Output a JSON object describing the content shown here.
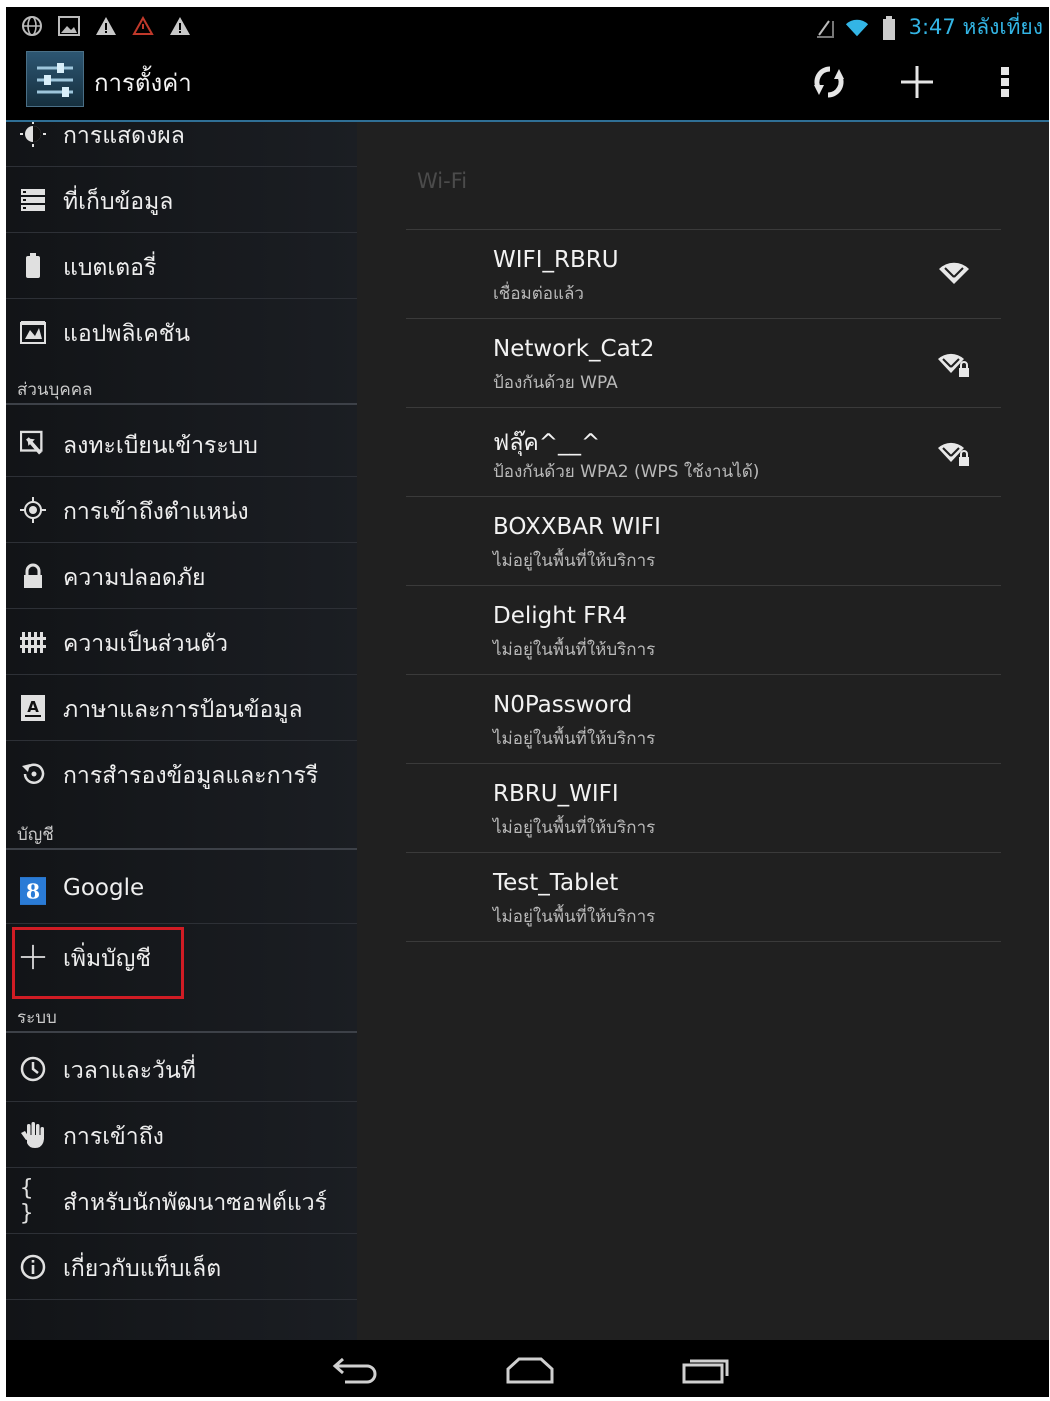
{
  "status_bar": {
    "time": "3:47 หลังเที่ยง",
    "left_icons": [
      "globe-icon",
      "image-icon",
      "warning-icon",
      "warning-outline-icon",
      "warning-icon"
    ],
    "right_icons": [
      "no-signal-icon",
      "wifi-icon",
      "battery-icon"
    ]
  },
  "action_bar": {
    "title": "การตั้งค่า",
    "actions": [
      "sync-icon",
      "add-icon",
      "overflow-menu-icon"
    ]
  },
  "sidebar": {
    "items": [
      {
        "label": "การแสดงผล",
        "icon": "brightness-icon"
      },
      {
        "label": "ที่เก็บข้อมูล",
        "icon": "storage-icon"
      },
      {
        "label": "แบตเตอรี่",
        "icon": "battery-icon"
      },
      {
        "label": "แอปพลิเคชัน",
        "icon": "apps-icon"
      },
      {
        "header": "ส่วนบุคคล"
      },
      {
        "label": "ลงทะเบียนเข้าระบบ",
        "icon": "signin-icon"
      },
      {
        "label": "การเข้าถึงตำแหน่ง",
        "icon": "location-icon"
      },
      {
        "label": "ความปลอดภัย",
        "icon": "lock-icon"
      },
      {
        "label": "ความเป็นส่วนตัว",
        "icon": "privacy-icon"
      },
      {
        "label": "ภาษาและการป้อนข้อมูล",
        "icon": "language-icon"
      },
      {
        "label": "การสำรองข้อมูลและการรี",
        "icon": "backup-icon"
      },
      {
        "header": "บัญชี"
      },
      {
        "label": "Google",
        "icon": "google-icon"
      },
      {
        "label": "เพิ่มบัญชี",
        "icon": "add-account-icon"
      },
      {
        "header": "ระบบ"
      },
      {
        "label": "เวลาและวันที่",
        "icon": "clock-icon"
      },
      {
        "label": "การเข้าถึง",
        "icon": "hand-icon"
      },
      {
        "label": "สำหรับนักพัฒนาซอฟต์แวร์",
        "icon": "braces-icon"
      },
      {
        "label": "เกี่ยวกับแท็บเล็ต",
        "icon": "info-icon"
      }
    ]
  },
  "wifi": {
    "header": "Wi-Fi",
    "networks": [
      {
        "ssid": "WIFI_RBRU",
        "status": "เชื่อมต่อแล้ว",
        "signal_icon": "wifi-signal-icon"
      },
      {
        "ssid": "Network_Cat2",
        "status": "ป้องกันด้วย WPA",
        "signal_icon": "wifi-locked-icon"
      },
      {
        "ssid": "ฟลุ๊ค^__^",
        "status": "ป้องกันด้วย WPA2 (WPS ใช้งานได้)",
        "signal_icon": "wifi-locked-icon"
      },
      {
        "ssid": "BOXXBAR WIFI",
        "status": "ไม่อยู่ในพื้นที่ให้บริการ"
      },
      {
        "ssid": "Delight FR4",
        "status": "ไม่อยู่ในพื้นที่ให้บริการ"
      },
      {
        "ssid": "N0Password",
        "status": "ไม่อยู่ในพื้นที่ให้บริการ"
      },
      {
        "ssid": "RBRU_WIFI",
        "status": "ไม่อยู่ในพื้นที่ให้บริการ"
      },
      {
        "ssid": "Test_Tablet",
        "status": "ไม่อยู่ในพื้นที่ให้บริการ"
      }
    ]
  },
  "nav_bar": [
    "back-icon",
    "home-icon",
    "recents-icon"
  ],
  "colors": {
    "accent": "#33b5e5",
    "highlight_box": "#d01c24"
  }
}
